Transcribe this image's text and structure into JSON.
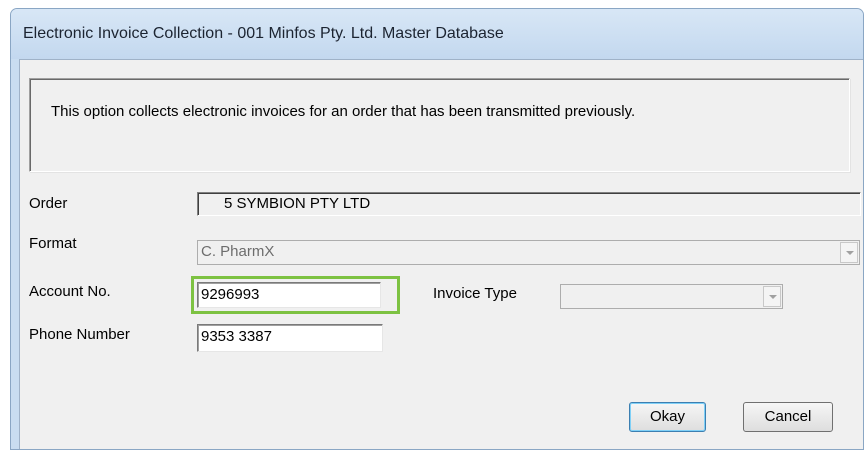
{
  "window": {
    "title": "Electronic Invoice Collection - 001 Minfos Pty. Ltd. Master Database"
  },
  "info": {
    "text": "This option collects electronic invoices for an order that has been transmitted previously."
  },
  "form": {
    "order_label": "Order",
    "order_value": "5  SYMBION PTY LTD",
    "format_label": "Format",
    "format_value": "C. PharmX",
    "account_label": "Account No.",
    "account_value": "9296993",
    "invoice_type_label": "Invoice Type",
    "invoice_type_value": "",
    "phone_label": "Phone Number",
    "phone_value": "9353 3387"
  },
  "buttons": {
    "okay": "Okay",
    "cancel": "Cancel"
  },
  "colors": {
    "highlight": "#7dc242",
    "title_bar": "#c9ddf1"
  }
}
